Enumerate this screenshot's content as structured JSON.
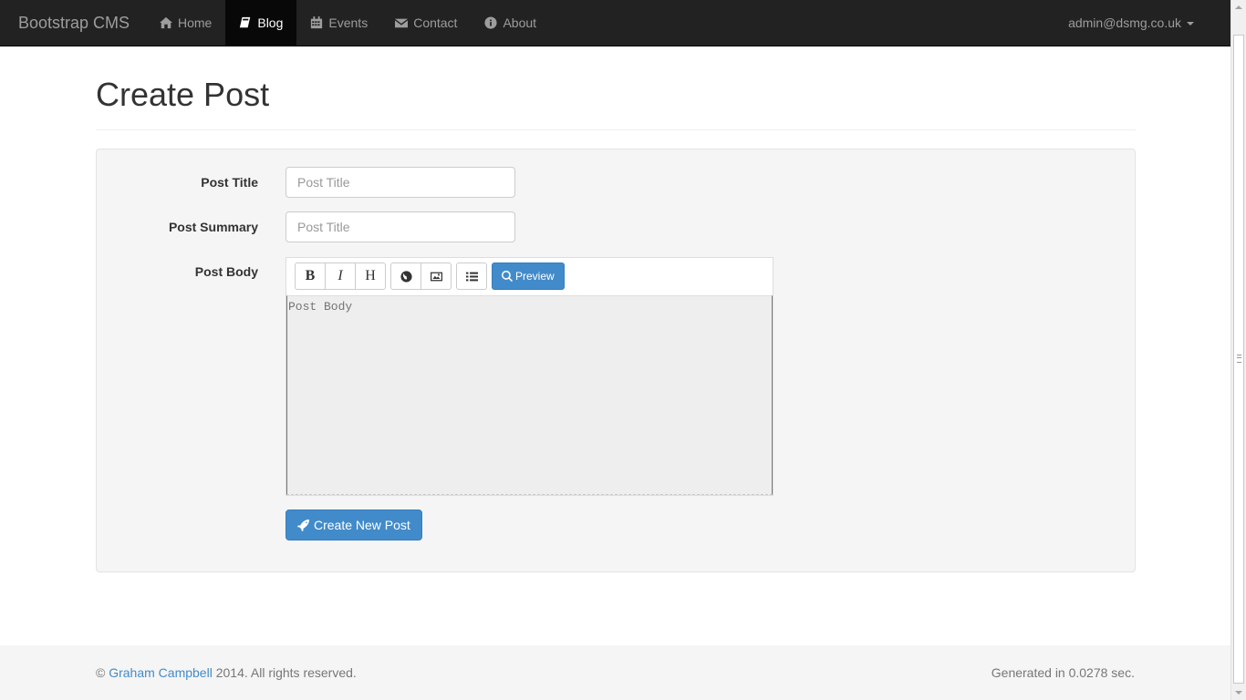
{
  "navbar": {
    "brand": "Bootstrap CMS",
    "items": [
      {
        "label": "Home",
        "icon": "home-icon",
        "active": false
      },
      {
        "label": "Blog",
        "icon": "book-icon",
        "active": true
      },
      {
        "label": "Events",
        "icon": "calendar-icon",
        "active": false
      },
      {
        "label": "Contact",
        "icon": "envelope-icon",
        "active": false
      },
      {
        "label": "About",
        "icon": "info-icon",
        "active": false
      }
    ],
    "user": "admin@dsmg.co.uk"
  },
  "page": {
    "title": "Create Post"
  },
  "form": {
    "title_label": "Post Title",
    "title_placeholder": "Post Title",
    "title_value": "",
    "summary_label": "Post Summary",
    "summary_placeholder": "Post Title",
    "summary_value": "",
    "body_label": "Post Body",
    "body_placeholder": "Post Body",
    "body_value": "",
    "toolbar": {
      "bold": "B",
      "italic": "I",
      "heading": "H",
      "link_icon": "globe-icon",
      "image_icon": "image-icon",
      "list_icon": "list-icon",
      "preview_label": "Preview"
    },
    "submit_label": "Create New Post"
  },
  "footer": {
    "copyright_symbol": "©",
    "author": "Graham Campbell",
    "copyright_rest": "2014. All rights reserved.",
    "generated": "Generated in 0.0278 sec."
  },
  "colors": {
    "navbar_bg": "#222222",
    "primary": "#428bca",
    "well_bg": "#f5f5f5"
  }
}
